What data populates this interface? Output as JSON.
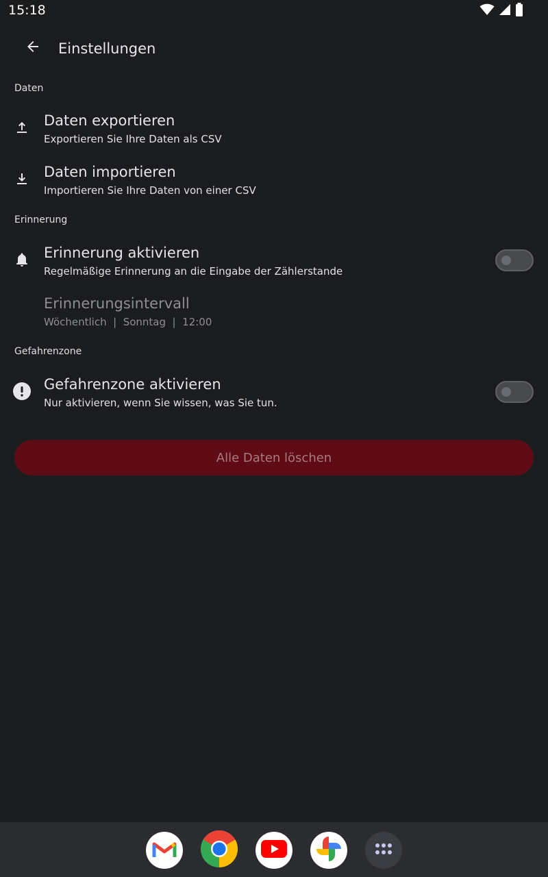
{
  "statusbar": {
    "time": "15:18",
    "icons": [
      "wifi-icon",
      "signal-icon",
      "battery-icon"
    ]
  },
  "appbar": {
    "back_icon": "arrow-back-icon",
    "title": "Einstellungen"
  },
  "sections": {
    "data": {
      "title": "Daten",
      "export": {
        "icon": "upload-icon",
        "title": "Daten exportieren",
        "subtitle": "Exportieren Sie Ihre Daten als CSV"
      },
      "import": {
        "icon": "download-icon",
        "title": "Daten importieren",
        "subtitle": "Importieren Sie Ihre Daten von einer CSV"
      }
    },
    "reminder": {
      "title": "Erinnerung",
      "enable": {
        "icon": "bell-icon",
        "title": "Erinnerung aktivieren",
        "subtitle": "Regelmäßige Erinnerung an die Eingabe der Zählerstande",
        "toggle_on": false
      },
      "interval": {
        "title": "Erinnerungsintervall",
        "subtitle": "Wöchentlich  |  Sonntag  |  12:00",
        "enabled": false
      }
    },
    "danger": {
      "title": "Gefahrenzone",
      "enable": {
        "icon": "warning-circle-icon",
        "title": "Gefahrenzone aktivieren",
        "subtitle": "Nur aktivieren, wenn Sie wissen, was Sie tun.",
        "toggle_on": false
      },
      "delete_button": "Alle Daten löschen"
    }
  },
  "dock": {
    "apps": [
      "gmail-icon",
      "chrome-icon",
      "youtube-icon",
      "photos-icon",
      "app-drawer-icon"
    ]
  },
  "colors": {
    "background": "#1b1c1e",
    "danger_button": "#5e0b16",
    "dock": "#2b2c30"
  }
}
